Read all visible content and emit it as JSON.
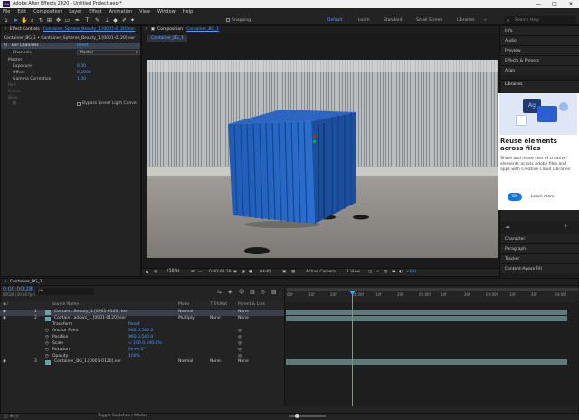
{
  "window": {
    "title": "Adobe After Effects 2020 - Untitled Project.aep *",
    "app_abbr": "Ae",
    "minimize": "—",
    "maximize": "□",
    "close": "✕"
  },
  "menu": [
    "File",
    "Edit",
    "Composition",
    "Layer",
    "Effect",
    "Animation",
    "View",
    "Window",
    "Help"
  ],
  "toolbar": {
    "snapping_label": "Snapping",
    "workspaces": [
      "Default",
      "Learn",
      "Standard",
      "Small Screen",
      "Libraries"
    ],
    "active_workspace": "Default",
    "search_placeholder": "Search Help"
  },
  "effect_controls": {
    "tab_label": "Effect Controls",
    "tab_layer": "Container_Sphere_Beauty_1.[0001-0120].exr",
    "path": "Container_BG_1 • Container_Spheres_Beauty_1.[0001-0120].exr",
    "effect_name": "Exr Channels",
    "reset": "Reset",
    "channels_label": "Channels",
    "channels_value": "Master",
    "section": "Master",
    "exposure_label": "Exposure",
    "exposure_value": "0.00",
    "offset_label": "Offset",
    "offset_value": "0.0000",
    "gamma_label": "Gamma Correction",
    "gamma_value": "1.00",
    "red_label": "Red",
    "green_label": "Green",
    "blue_label": "Blue",
    "bypass_label": "Bypass Linear Light Conve"
  },
  "composition": {
    "tab_label": "Composition",
    "tab_name": "Container_BG_1",
    "sub_tab": "Container_BG_1",
    "zoom": "(50%)",
    "timecode": "0:00:00:28",
    "resolution": "(Half)",
    "camera": "Active Camera",
    "views": "1 View",
    "exposure": "+0.0"
  },
  "right_panel": {
    "items": [
      "Info",
      "Audio",
      "Preview",
      "Effects & Presets",
      "Align"
    ],
    "libraries_title": "Libraries",
    "promo_title": "Reuse elements across files",
    "promo_body": "Share and reuse sets of creative elements across Adobe files and apps with Creative Cloud Libraries",
    "ok_label": "OK",
    "learn_more": "Learn more",
    "lower_items": [
      "Character",
      "Paragraph",
      "Tracker",
      "Content-Aware Fill"
    ]
  },
  "timeline": {
    "tab_name": "Container_BG_1",
    "timecode": "0:00:00:28",
    "timecode_sub": "00028 (30.00 fps)",
    "search_placeholder": "ρ▾",
    "col_source": "Source Name",
    "col_mode": "Mode",
    "col_trkmat": "T TrkMat",
    "col_parent": "Parent & Link",
    "ruler_labels": [
      "00f",
      "10f",
      "20f",
      "01:00f",
      "10f",
      "20f",
      "02:00f",
      "10f",
      "20f",
      "03:00f",
      "10f",
      "20f",
      "04:00f"
    ],
    "layers": [
      {
        "num": "1",
        "name": "Contain...Beauty_1.[0001-0120].exr",
        "mode": "Normal",
        "trkmat": "",
        "parent": "None"
      },
      {
        "num": "2",
        "name": "Contain...adows_1.[0001-0120].exr",
        "mode": "Multiply",
        "trkmat": "None",
        "parent": "None"
      },
      {
        "num": "3",
        "name": "Container_BG_1.[0001-0120].exr",
        "mode": "Normal",
        "trkmat": "None",
        "parent": "None"
      }
    ],
    "transform_label": "Transform",
    "transform_reset": "Reset",
    "props": [
      {
        "name": "Anchor Point",
        "value": "960.0,540.0"
      },
      {
        "name": "Position",
        "value": "960.0,540.0"
      },
      {
        "name": "Scale",
        "value": "∞ 100.0,100.0%"
      },
      {
        "name": "Rotation",
        "value": "0x+0.0°"
      },
      {
        "name": "Opacity",
        "value": "100%"
      }
    ],
    "footer_toggle": "Toggle Switches / Modes"
  }
}
